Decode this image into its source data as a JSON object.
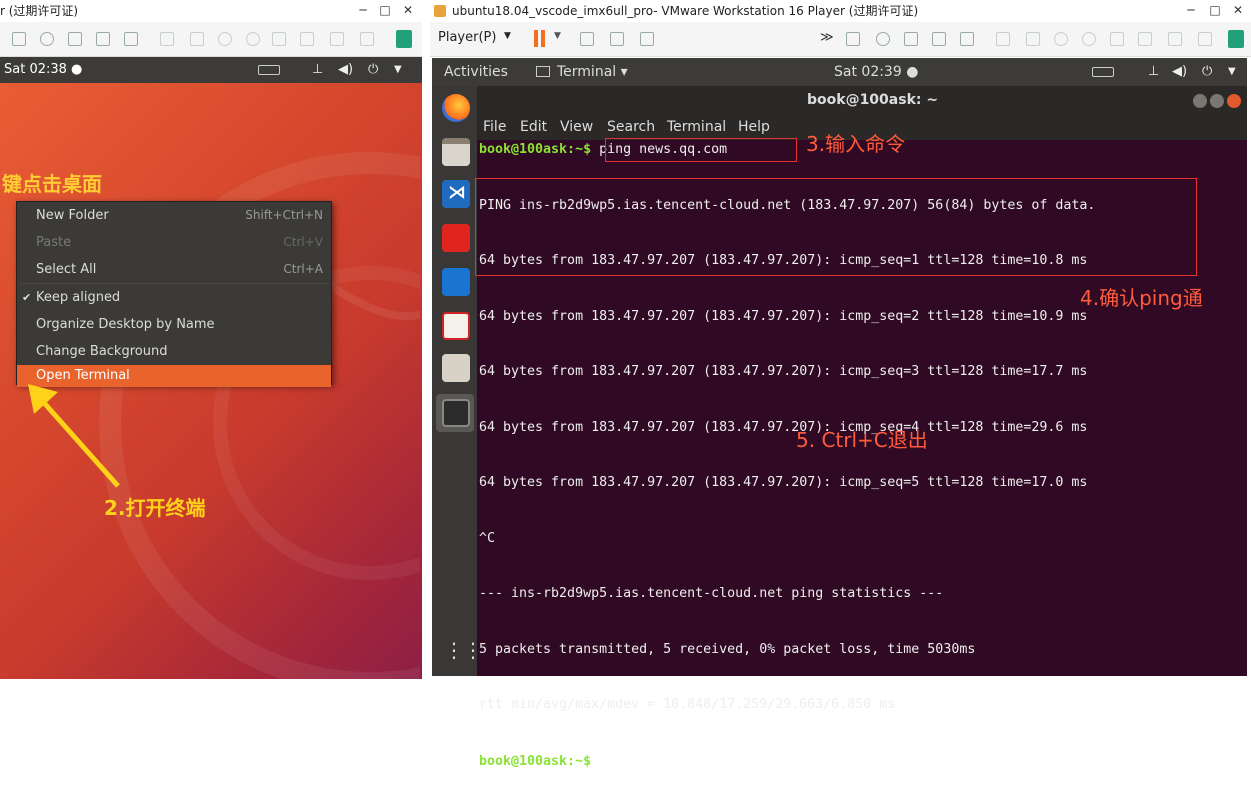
{
  "left_window": {
    "title": "r (过期许可证)",
    "win_buttons": [
      "─",
      "□",
      "✕"
    ],
    "topbar_time": "Sat 02:38 ●",
    "context_menu": [
      {
        "label": "New Folder",
        "accel": "Shift+Ctrl+N",
        "state": "normal"
      },
      {
        "label": "Paste",
        "accel": "Ctrl+V",
        "state": "disabled"
      },
      {
        "label": "Select All",
        "accel": "Ctrl+A",
        "state": "normal"
      },
      {
        "label": "Keep aligned",
        "accel": "",
        "state": "checked",
        "check": "✔"
      },
      {
        "label": "Organize Desktop by Name",
        "accel": "",
        "state": "normal"
      },
      {
        "label": "Change Background",
        "accel": "",
        "state": "normal"
      },
      {
        "label": "Open Terminal",
        "accel": "",
        "state": "selected"
      }
    ],
    "annotation_right_click": "键点击桌面",
    "annotation_open_terminal": "2.打开终端"
  },
  "right_window": {
    "title": "ubuntu18.04_vscode_imx6ull_pro- VMware Workstation 16 Player (过期许可证)",
    "win_buttons": [
      "─",
      "□",
      "✕"
    ],
    "player_menu": "Player(P)",
    "activities": "Activities",
    "terminal_app_menu": "Terminal ▾",
    "topbar_time": "Sat 02:39 ●",
    "terminal_title": "book@100ask: ~",
    "menubar": [
      "File",
      "Edit",
      "View",
      "Search",
      "Terminal",
      "Help"
    ],
    "prompt": "book@100ask:~$",
    "command": " ping news.qq.com",
    "lines": [
      "PING ins-rb2d9wp5.ias.tencent-cloud.net (183.47.97.207) 56(84) bytes of data.",
      "64 bytes from 183.47.97.207 (183.47.97.207): icmp_seq=1 ttl=128 time=10.8 ms",
      "64 bytes from 183.47.97.207 (183.47.97.207): icmp_seq=2 ttl=128 time=10.9 ms",
      "64 bytes from 183.47.97.207 (183.47.97.207): icmp_seq=3 ttl=128 time=17.7 ms",
      "64 bytes from 183.47.97.207 (183.47.97.207): icmp_seq=4 ttl=128 time=29.6 ms",
      "64 bytes from 183.47.97.207 (183.47.97.207): icmp_seq=5 ttl=128 time=17.0 ms",
      "^C",
      "--- ins-rb2d9wp5.ias.tencent-cloud.net ping statistics ---",
      "5 packets transmitted, 5 received, 0% packet loss, time 5030ms",
      "rtt min/avg/max/mdev = 10.848/17.259/29.663/6.850 ms"
    ],
    "final_prompt": "book@100ask:~$",
    "annotation_enter_command": "3.输入命令",
    "annotation_confirm_ping": "4.确认ping通",
    "annotation_exit": "5. Ctrl+C退出"
  },
  "colors": {
    "annotation": "#ff5a3a",
    "prompt": "#8ae234",
    "terminal_bg": "#300a24",
    "menu_selected": "#e9642d"
  }
}
